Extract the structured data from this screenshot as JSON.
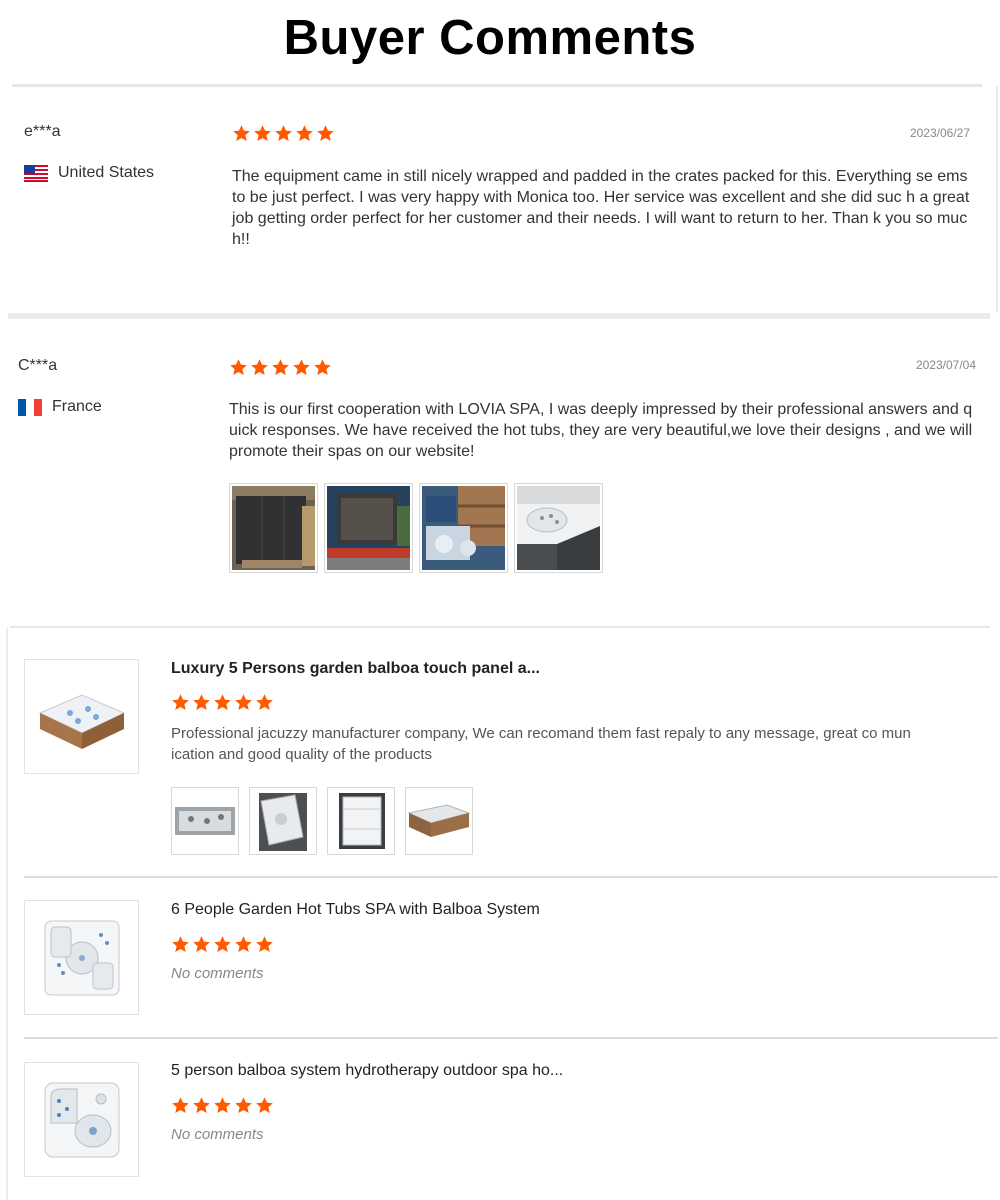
{
  "page": {
    "title": "Buyer Comments"
  },
  "colors": {
    "star": "#ff5a00",
    "separator": "#e6e6e6"
  },
  "reviews": [
    {
      "name": "e***a",
      "country": "United States",
      "flag_icon": "us-flag-icon",
      "date": "2023/06/27",
      "rating": 5,
      "text": "The equipment came in still nicely wrapped and padded in the crates packed for this. Everything se ems to be just perfect. I was very happy with Monica too. Her service was excellent and she did suc h a great job getting order perfect for her customer and their needs. I will want to return to her. Than k you so much!!"
    },
    {
      "name": "C***a",
      "country": "France",
      "flag_icon": "france-flag-icon",
      "date": "2023/07/04",
      "rating": 5,
      "text": "This is our first cooperation with LOVIA SPA, I was deeply impressed by their professional answers and quick responses. We have received the hot tubs, they are very beautiful,we love their designs , and we will promote their spas on our website!",
      "photos": [
        "crate-photo",
        "truck-photo",
        "parts-photo",
        "spa-photo"
      ]
    }
  ],
  "products": [
    {
      "title": "Luxury 5 Persons garden balboa touch panel a...",
      "rating": 5,
      "comment": "Professional jacuzzy manufacturer company, We can recomand them fast repaly to any message, great co munication and good quality of the products",
      "photos": [
        "spa-top-photo",
        "spa-install-photo",
        "spa-wrapped-photo",
        "spa-side-photo"
      ]
    },
    {
      "title": "6 People Garden Hot Tubs SPA with Balboa System",
      "rating": 5,
      "comment": "No comments"
    },
    {
      "title": "5 person balboa system hydrotherapy outdoor spa ho...",
      "rating": 5,
      "comment": "No comments"
    }
  ]
}
